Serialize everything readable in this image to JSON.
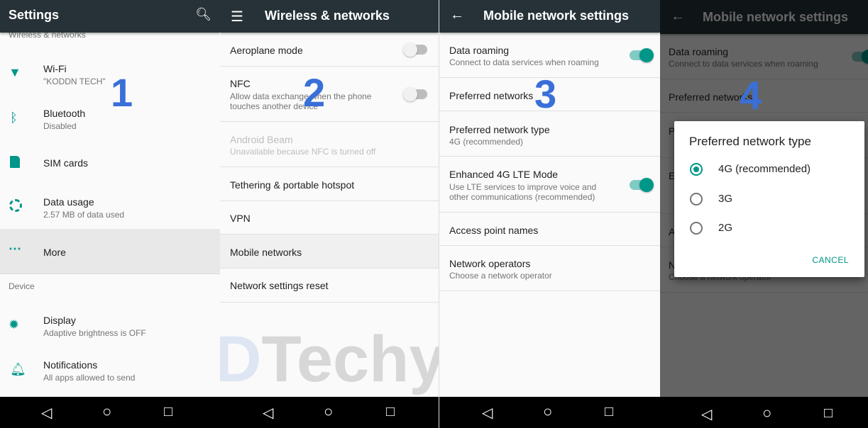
{
  "panel1": {
    "title": "Settings",
    "section1": "Wireless & networks",
    "items": [
      {
        "title": "Wi-Fi",
        "sub": "\"KODDN TECH\""
      },
      {
        "title": "Bluetooth",
        "sub": "Disabled"
      },
      {
        "title": "SIM cards"
      },
      {
        "title": "Data usage",
        "sub": "2.57 MB of data used"
      },
      {
        "title": "More"
      }
    ],
    "section2": "Device",
    "device": [
      {
        "title": "Display",
        "sub": "Adaptive brightness is OFF"
      },
      {
        "title": "Notifications",
        "sub": "All apps allowed to send"
      }
    ],
    "step": "1"
  },
  "panel2": {
    "title": "Wireless & networks",
    "items": [
      {
        "title": "Aeroplane mode",
        "toggle": false
      },
      {
        "title": "NFC",
        "sub": "Allow data exchange when the phone touches another device",
        "toggle": false
      },
      {
        "title": "Android Beam",
        "sub": "Unavailable because NFC is turned off",
        "disabled": true
      },
      {
        "title": "Tethering & portable hotspot"
      },
      {
        "title": "VPN"
      },
      {
        "title": "Mobile networks"
      },
      {
        "title": "Network settings reset"
      }
    ],
    "step": "2",
    "watermark_a": "D",
    "watermark_b": "Techy"
  },
  "panel3": {
    "title": "Mobile network settings",
    "items": [
      {
        "title": "Data roaming",
        "sub": "Connect to data services when roaming",
        "toggle": true
      },
      {
        "title": "Preferred networks"
      },
      {
        "title": "Preferred network type",
        "sub": "4G (recommended)"
      },
      {
        "title": "Enhanced 4G LTE Mode",
        "sub1": "Use LTE services to improve voice and",
        "sub2": "other communications (recommended)",
        "toggle": true
      },
      {
        "title": "Access point names"
      },
      {
        "title": "Network operators",
        "sub": "Choose a network operator"
      }
    ],
    "step": "3"
  },
  "panel4": {
    "step": "4",
    "dialog": {
      "title": "Preferred network type",
      "options": [
        "4G (recommended)",
        "3G",
        "2G"
      ],
      "selected": "4G (recommended)",
      "cancel": "CANCEL"
    }
  },
  "nav": {
    "back": "◁",
    "home": "○",
    "recents": "□"
  },
  "colors": {
    "accent": "#009688",
    "toolbar": "#263238",
    "step_number": "#3a6fd8"
  }
}
